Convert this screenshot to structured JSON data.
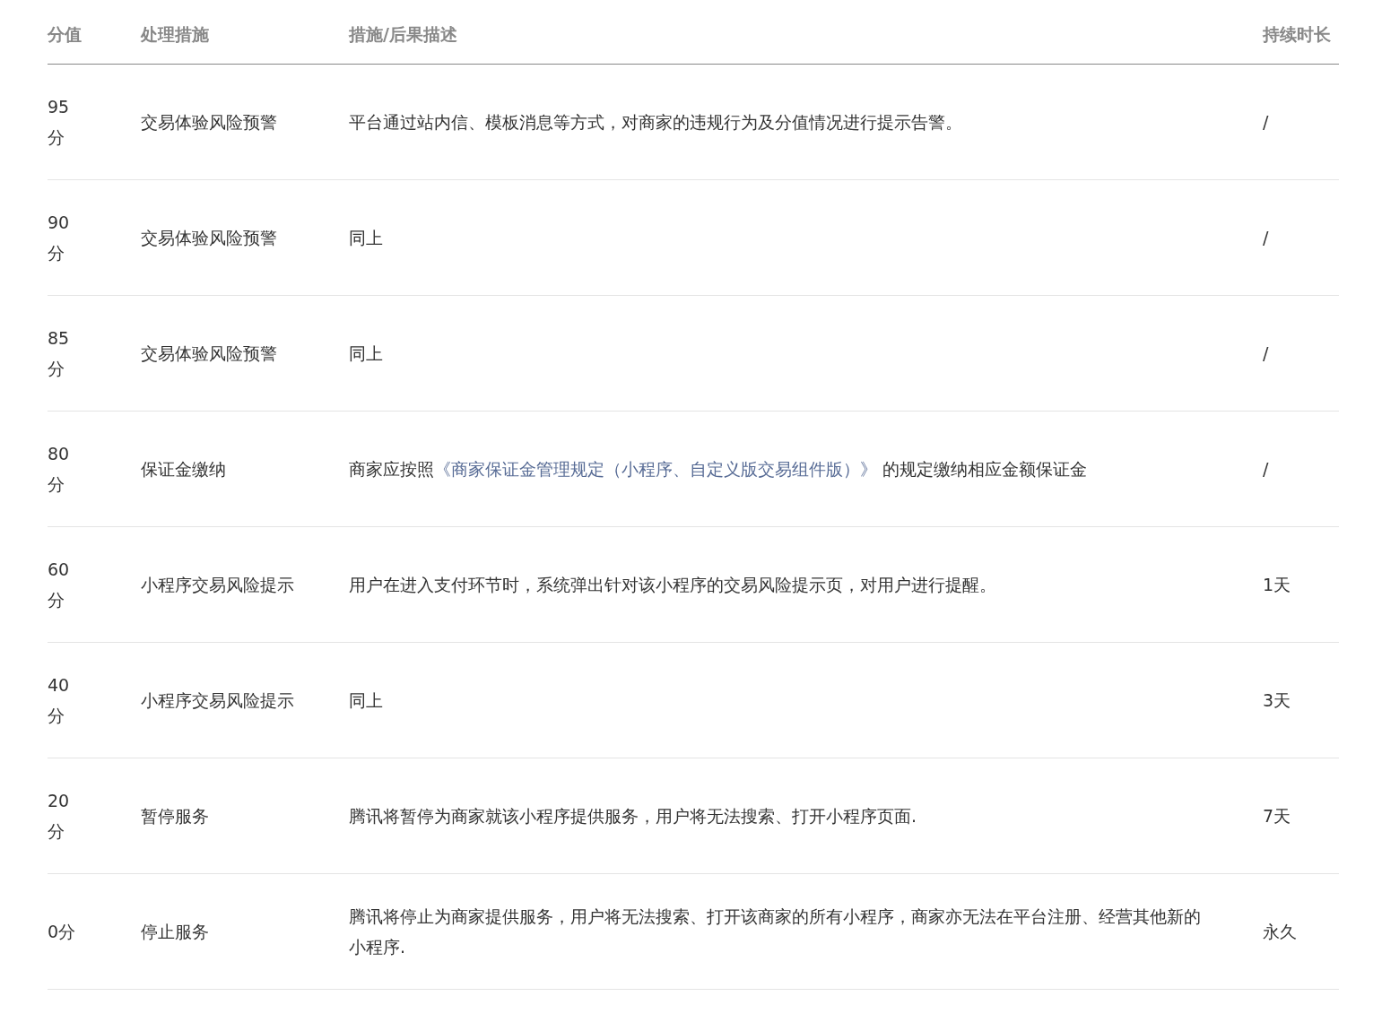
{
  "table": {
    "columns": [
      "分值",
      "处理措施",
      "措施/后果描述",
      "持续时长"
    ],
    "rows": [
      {
        "score": "95 分",
        "measure": "交易体验风险预警",
        "description": [
          {
            "kind": "text",
            "text": "平台通过站内信、模板消息等方式，对商家的违规行为及分值情况进行提示告警。"
          }
        ],
        "duration": "/"
      },
      {
        "score": "90 分",
        "measure": "交易体验风险预警",
        "description": [
          {
            "kind": "text",
            "text": "同上"
          }
        ],
        "duration": "/"
      },
      {
        "score": "85 分",
        "measure": "交易体验风险预警",
        "description": [
          {
            "kind": "text",
            "text": "同上"
          }
        ],
        "duration": "/"
      },
      {
        "score": "80 分",
        "measure": "保证金缴纳",
        "description": [
          {
            "kind": "text",
            "text": "商家应按照"
          },
          {
            "kind": "link",
            "text": "《商家保证金管理规定（小程序、自定义版交易组件版）》"
          },
          {
            "kind": "text",
            "text": " 的规定缴纳相应金额保证金"
          }
        ],
        "duration": "/"
      },
      {
        "score": "60 分",
        "measure": "小程序交易风险提示",
        "description": [
          {
            "kind": "text",
            "text": "用户在进入支付环节时，系统弹出针对该小程序的交易风险提示页，对用户进行提醒。"
          }
        ],
        "duration": "1天"
      },
      {
        "score": "40 分",
        "measure": "小程序交易风险提示",
        "description": [
          {
            "kind": "text",
            "text": "同上"
          }
        ],
        "duration": "3天"
      },
      {
        "score": "20 分",
        "measure": "暂停服务",
        "description": [
          {
            "kind": "text",
            "text": "腾讯将暂停为商家就该小程序提供服务，用户将无法搜索、打开小程序页面."
          }
        ],
        "duration": "7天"
      },
      {
        "score": "0分",
        "measure": "停止服务",
        "description": [
          {
            "kind": "text",
            "text": "腾讯将停止为商家提供服务，用户将无法搜索、打开该商家的所有小程序，商家亦无法在平台注册、经营其他新的小程序."
          }
        ],
        "duration": "永久"
      }
    ]
  }
}
